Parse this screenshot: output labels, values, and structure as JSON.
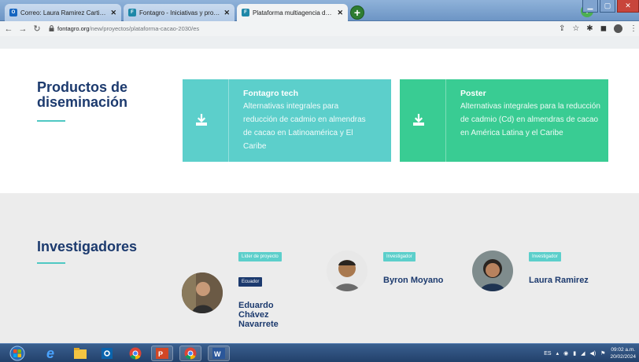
{
  "browser": {
    "tabs": [
      {
        "title": "Correo: Laura Ramirez Cartin - Ou",
        "favicon": "outlook-icon",
        "color": "#1565c0",
        "active": false
      },
      {
        "title": "Fontagro - Iniciativas y proyectos",
        "favicon": "fontagro-icon",
        "color": "#1e88a8",
        "active": false
      },
      {
        "title": "Plataforma multiagencia de cacao",
        "favicon": "fontagro-icon",
        "color": "#1e88a8",
        "active": true
      }
    ],
    "new_tab_label": "+",
    "profile_initial": "v",
    "url_host": "fontagro.org",
    "url_path": "/new/proyectos/plataforma-cacao-2030/es"
  },
  "diseminacion": {
    "title_line1": "Productos de",
    "title_line2": "diseminación",
    "cards": [
      {
        "title": "Fontagro tech",
        "description": "Alternativas integrales para reducción de cadmio en almendras de cacao en Latinoamérica y El Caribe",
        "color": "#5ccfcb",
        "icon": "download-icon"
      },
      {
        "title": "Poster",
        "description": "Alternativas integrales para la reducción de cadmio (Cd) en almendras de cacao en América Latina y el Caribe",
        "color": "#39cc93",
        "icon": "download-icon"
      }
    ]
  },
  "investigadores": {
    "title": "Investigadores",
    "people": [
      {
        "role": "Líder de proyecto",
        "country": "Ecuador",
        "name_lines": [
          "Eduardo",
          "Chávez",
          "Navarrete"
        ]
      },
      {
        "role": "Investigador",
        "name_lines": [
          "Byron Moyano"
        ]
      },
      {
        "role": "Investigador",
        "name_lines": [
          "Laura Ramirez"
        ]
      }
    ]
  },
  "colors": {
    "navy": "#1c3a6e",
    "teal": "#5ccfcb",
    "green": "#39cc93",
    "badge": "#5ccfcb",
    "badge_dark": "#1c3a6e"
  },
  "taskbar": {
    "language": "ES",
    "time": "09:02 a.m.",
    "date": "20/02/2024",
    "apps": [
      "start-orb-icon",
      "internet-explorer-icon",
      "file-explorer-icon",
      "outlook-icon",
      "chrome-icon",
      "powerpoint-icon",
      "chrome-icon",
      "word-icon"
    ]
  }
}
